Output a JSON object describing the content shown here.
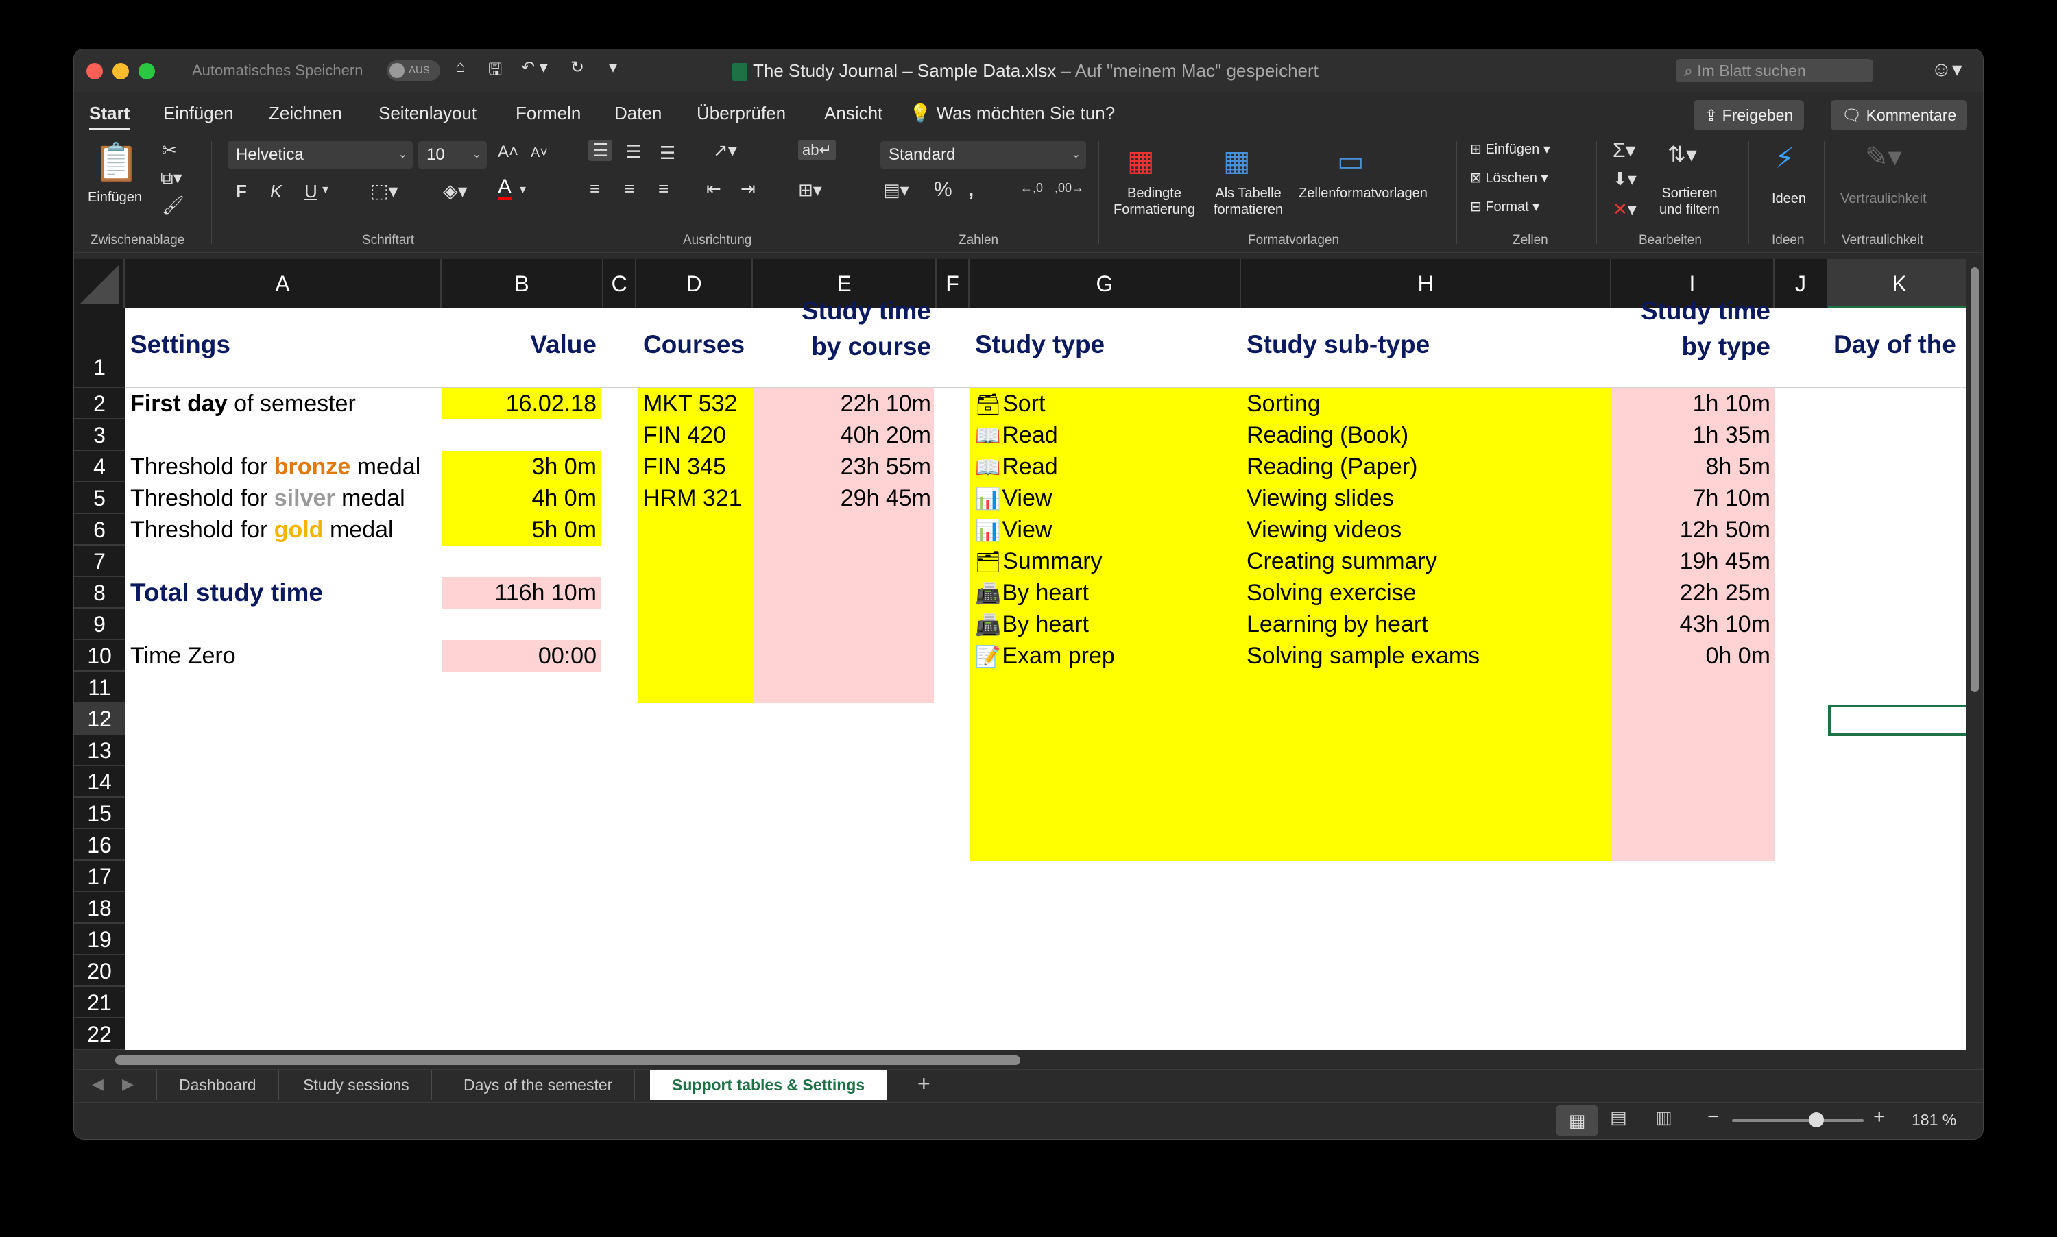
{
  "titlebar": {
    "autosave_label": "Automatisches Speichern",
    "autosave_state": "AUS",
    "file_name": "The Study Journal – Sample Data.xlsx",
    "save_location": "– Auf \"meinem Mac\" gespeichert",
    "search_placeholder": "Im Blatt suchen"
  },
  "ribbon_tabs": [
    "Start",
    "Einfügen",
    "Zeichnen",
    "Seitenlayout",
    "Formeln",
    "Daten",
    "Überprüfen",
    "Ansicht"
  ],
  "tell_me": "Was möchten Sie tun?",
  "share_label": "Freigeben",
  "comments_label": "Kommentare",
  "ribbon": {
    "paste": "Einfügen",
    "font_name": "Helvetica",
    "font_size": "10",
    "bold": "F",
    "italic": "K",
    "underline": "U",
    "number_format": "Standard",
    "cond_format": [
      "Bedingte",
      "Formatierung"
    ],
    "as_table": [
      "Als Tabelle",
      "formatieren"
    ],
    "cell_styles": "Zellenformatvorlagen",
    "insert_cells": "Einfügen",
    "delete_cells": "Löschen",
    "format_cells": "Format",
    "sort_filter": [
      "Sortieren",
      "und filtern"
    ],
    "ideas": "Ideen",
    "sensitivity": "Vertraulichkeit",
    "groups": [
      "Zwischenablage",
      "Schriftart",
      "Ausrichtung",
      "Zahlen",
      "Formatvorlagen",
      "Zellen",
      "Bearbeiten",
      "Ideen",
      "Vertraulichkeit"
    ]
  },
  "columns": [
    "A",
    "B",
    "C",
    "D",
    "E",
    "F",
    "G",
    "H",
    "I",
    "J",
    "K"
  ],
  "rows": [
    "1",
    "2",
    "3",
    "4",
    "5",
    "6",
    "7",
    "8",
    "9",
    "10",
    "11",
    "12",
    "13",
    "14",
    "15",
    "16",
    "17",
    "18",
    "19",
    "20",
    "21",
    "22"
  ],
  "sheet": {
    "settings_header": "Settings",
    "value_header": "Value",
    "courses_header": "Courses",
    "study_time_course": [
      "Study time",
      "by course"
    ],
    "study_type_header": "Study type",
    "study_subtype_header": "Study sub-type",
    "study_time_type": [
      "Study time",
      "by type"
    ],
    "day_header": "Day of the",
    "first_day_bold": "First day",
    "first_day_rest": " of semester",
    "first_day_value": "16.02.18",
    "threshold_prefix": "Threshold for ",
    "medal_suffix": " medal",
    "bronze": "bronze",
    "silver": "silver",
    "gold": "gold",
    "bronze_value": "3h 0m",
    "silver_value": "4h 0m",
    "gold_value": "5h 0m",
    "total_label": "Total study time",
    "total_value": "116h 10m",
    "time_zero_label": "Time Zero",
    "time_zero_value": "00:00",
    "courses": [
      {
        "code": "MKT 532",
        "time": "22h 10m"
      },
      {
        "code": "FIN 420",
        "time": "40h 20m"
      },
      {
        "code": "FIN 345",
        "time": "23h 55m"
      },
      {
        "code": "HRM 321",
        "time": "29h 45m"
      }
    ],
    "study_types": [
      {
        "icon": "🗃",
        "type": "Sort",
        "subtype": "Sorting",
        "time": "1h 10m"
      },
      {
        "icon": "📖",
        "type": "Read",
        "subtype": "Reading (Book)",
        "time": "1h 35m"
      },
      {
        "icon": "📖",
        "type": "Read",
        "subtype": "Reading (Paper)",
        "time": "8h 5m"
      },
      {
        "icon": "📊",
        "type": "View",
        "subtype": "Viewing slides",
        "time": "7h 10m"
      },
      {
        "icon": "📊",
        "type": "View",
        "subtype": "Viewing videos",
        "time": "12h 50m"
      },
      {
        "icon": "🗂",
        "type": "Summary",
        "subtype": "Creating summary",
        "time": "19h 45m"
      },
      {
        "icon": "📠",
        "type": "By heart",
        "subtype": "Solving exercise",
        "time": "22h 25m"
      },
      {
        "icon": "📠",
        "type": "By heart",
        "subtype": "Learning by heart",
        "time": "43h 10m"
      },
      {
        "icon": "📝",
        "type": "Exam prep",
        "subtype": "Solving sample exams",
        "time": "0h 0m"
      }
    ]
  },
  "sheet_tabs": [
    "Dashboard",
    "Study sessions",
    "Days of the semester",
    "Support tables & Settings"
  ],
  "active_sheet": "Support tables & Settings",
  "zoom": "181 %",
  "colors": {
    "yellow": "#ffff00",
    "pink": "#ffd3d3",
    "header_navy": "#0b1a5e",
    "accent_green": "#1e7145"
  }
}
